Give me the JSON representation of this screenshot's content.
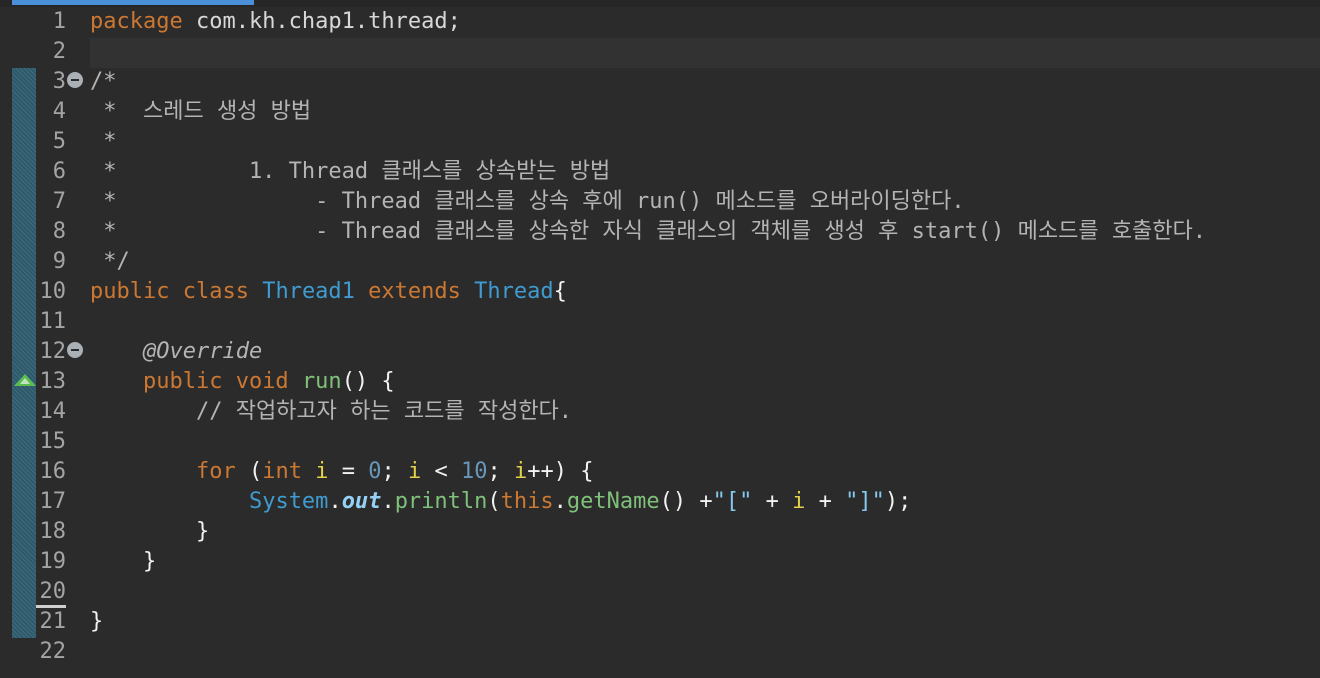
{
  "gutter": {
    "line_numbers": [
      "1",
      "2",
      "3",
      "4",
      "5",
      "6",
      "7",
      "8",
      "9",
      "10",
      "11",
      "12",
      "13",
      "14",
      "15",
      "16",
      "17",
      "18",
      "19",
      "20",
      "21",
      "22"
    ]
  },
  "code": {
    "l1_kw": "package",
    "l1_rest": " com.kh.chap1.thread;",
    "l3": "/*",
    "l4": " *  스레드 생성 방법",
    "l5": " *",
    "l6": " *          1. Thread 클래스를 상속받는 방법",
    "l7": " *               - Thread 클래스를 상속 후에 run() 메소드를 오버라이딩한다.",
    "l8": " *               - Thread 클래스를 상속한 자식 클래스의 객체를 생성 후 start() 메소드를 호출한다.",
    "l9": " */",
    "l10_kw1": "public class",
    "l10_cls1": "Thread1",
    "l10_kw2": "extends",
    "l10_cls2": "Thread",
    "l10_brace": "{",
    "l12_ann": "@Override",
    "l13_kw": "public void",
    "l13_fn": "run",
    "l13_rest": "() {",
    "l14_cm": "// 작업하고자 하는 코드를 작성한다.",
    "l16_for": "for",
    "l16_p1": " (",
    "l16_int": "int",
    "l16_i1": "i",
    "l16_eq": " = ",
    "l16_n0": "0",
    "l16_semi1": "; ",
    "l16_i2": "i",
    "l16_lt": " < ",
    "l16_n10": "10",
    "l16_semi2": "; ",
    "l16_i3": "i",
    "l16_end": "++) {",
    "l17_sys": "System",
    "l17_dot1": ".",
    "l17_out": "out",
    "l17_dot2": ".",
    "l17_println": "println",
    "l17_p1": "(",
    "l17_this": "this",
    "l17_dot3": ".",
    "l17_getname": "getName",
    "l17_call": "() +",
    "l17_s1": "\"[\"",
    "l17_plus1": " + ",
    "l17_i": "i",
    "l17_plus2": " + ",
    "l17_s2": "\"]\"",
    "l17_end": ");",
    "l18": "}",
    "l19": "}",
    "l21": "}"
  }
}
